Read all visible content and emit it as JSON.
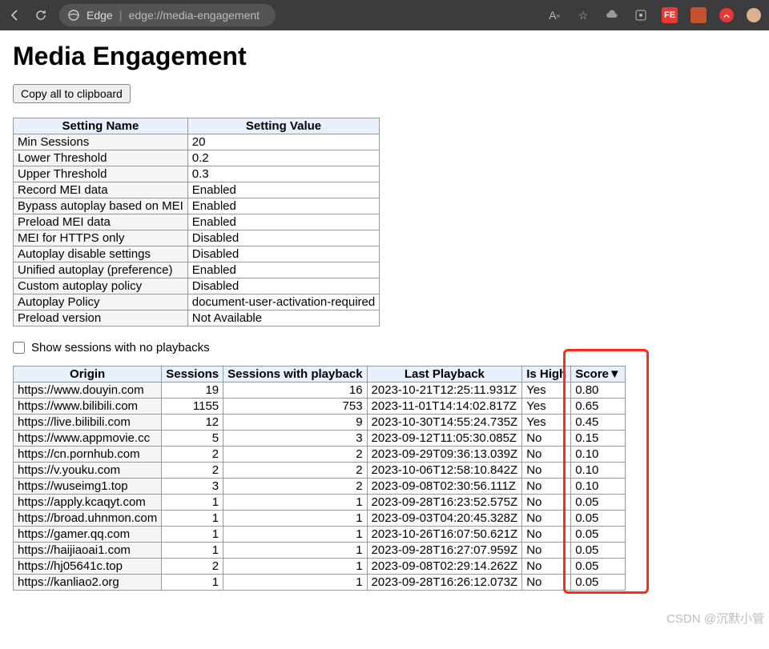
{
  "browser": {
    "edge_label": "Edge",
    "url": "edge://media-engagement",
    "ext_fe": "FE"
  },
  "heading": "Media Engagement",
  "copy_btn": "Copy all to clipboard",
  "settings_headers": {
    "name": "Setting Name",
    "value": "Setting Value"
  },
  "settings": [
    {
      "name": "Min Sessions",
      "value": "20"
    },
    {
      "name": "Lower Threshold",
      "value": "0.2"
    },
    {
      "name": "Upper Threshold",
      "value": "0.3"
    },
    {
      "name": "Record MEI data",
      "value": "Enabled"
    },
    {
      "name": "Bypass autoplay based on MEI",
      "value": "Enabled"
    },
    {
      "name": "Preload MEI data",
      "value": "Enabled"
    },
    {
      "name": "MEI for HTTPS only",
      "value": "Disabled"
    },
    {
      "name": "Autoplay disable settings",
      "value": "Disabled"
    },
    {
      "name": "Unified autoplay (preference)",
      "value": "Enabled"
    },
    {
      "name": "Custom autoplay policy",
      "value": "Disabled"
    },
    {
      "name": "Autoplay Policy",
      "value": "document-user-activation-required"
    },
    {
      "name": "Preload version",
      "value": "Not Available"
    }
  ],
  "show_sessions_label": "Show sessions with no playbacks",
  "data_headers": {
    "origin": "Origin",
    "sessions": "Sessions",
    "sessions_playback": "Sessions with playback",
    "last_playback": "Last Playback",
    "is_high": "Is High",
    "score": "Score",
    "sort_indicator": "▼"
  },
  "rows": [
    {
      "origin": "https://www.douyin.com",
      "sessions": "19",
      "sessions_playback": "16",
      "last_playback": "2023-10-21T12:25:11.931Z",
      "is_high": "Yes",
      "score": "0.80"
    },
    {
      "origin": "https://www.bilibili.com",
      "sessions": "1155",
      "sessions_playback": "753",
      "last_playback": "2023-11-01T14:14:02.817Z",
      "is_high": "Yes",
      "score": "0.65"
    },
    {
      "origin": "https://live.bilibili.com",
      "sessions": "12",
      "sessions_playback": "9",
      "last_playback": "2023-10-30T14:55:24.735Z",
      "is_high": "Yes",
      "score": "0.45"
    },
    {
      "origin": "https://www.appmovie.cc",
      "sessions": "5",
      "sessions_playback": "3",
      "last_playback": "2023-09-12T11:05:30.085Z",
      "is_high": "No",
      "score": "0.15"
    },
    {
      "origin": "https://cn.pornhub.com",
      "sessions": "2",
      "sessions_playback": "2",
      "last_playback": "2023-09-29T09:36:13.039Z",
      "is_high": "No",
      "score": "0.10"
    },
    {
      "origin": "https://v.youku.com",
      "sessions": "2",
      "sessions_playback": "2",
      "last_playback": "2023-10-06T12:58:10.842Z",
      "is_high": "No",
      "score": "0.10"
    },
    {
      "origin": "https://wuseimg1.top",
      "sessions": "3",
      "sessions_playback": "2",
      "last_playback": "2023-09-08T02:30:56.111Z",
      "is_high": "No",
      "score": "0.10"
    },
    {
      "origin": "https://apply.kcaqyt.com",
      "sessions": "1",
      "sessions_playback": "1",
      "last_playback": "2023-09-28T16:23:52.575Z",
      "is_high": "No",
      "score": "0.05"
    },
    {
      "origin": "https://broad.uhnmon.com",
      "sessions": "1",
      "sessions_playback": "1",
      "last_playback": "2023-09-03T04:20:45.328Z",
      "is_high": "No",
      "score": "0.05"
    },
    {
      "origin": "https://gamer.qq.com",
      "sessions": "1",
      "sessions_playback": "1",
      "last_playback": "2023-10-26T16:07:50.621Z",
      "is_high": "No",
      "score": "0.05"
    },
    {
      "origin": "https://haijiaoai1.com",
      "sessions": "1",
      "sessions_playback": "1",
      "last_playback": "2023-09-28T16:27:07.959Z",
      "is_high": "No",
      "score": "0.05"
    },
    {
      "origin": "https://hj05641c.top",
      "sessions": "2",
      "sessions_playback": "1",
      "last_playback": "2023-09-08T02:29:14.262Z",
      "is_high": "No",
      "score": "0.05"
    },
    {
      "origin": "https://kanliao2.org",
      "sessions": "1",
      "sessions_playback": "1",
      "last_playback": "2023-09-28T16:26:12.073Z",
      "is_high": "No",
      "score": "0.05"
    }
  ],
  "watermark": "CSDN @沉默小管"
}
